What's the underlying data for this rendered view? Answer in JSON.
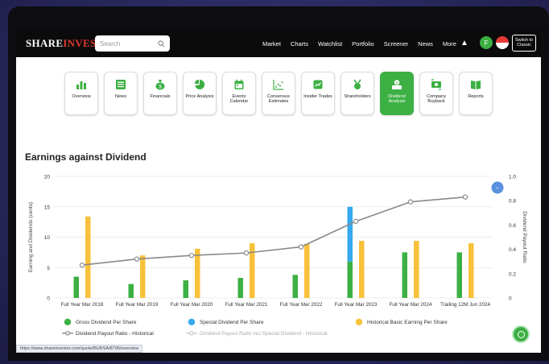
{
  "header": {
    "logo_part1": "SHARE",
    "logo_part2": "INVESTOR",
    "search_placeholder": "Search",
    "nav": [
      "Market",
      "Charts",
      "Watchlist",
      "Portfolio",
      "Screener",
      "News",
      "More"
    ],
    "avatar_letter": "F",
    "switch_label_1": "Switch to",
    "switch_label_2": "Classic"
  },
  "toolbar": [
    {
      "label": "Overview",
      "icon": "bar-chart-icon",
      "active": false
    },
    {
      "label": "News",
      "icon": "newspaper-icon",
      "active": false
    },
    {
      "label": "Financials",
      "icon": "money-bag-icon",
      "active": false
    },
    {
      "label": "Price Analysis",
      "icon": "pie-chart-icon",
      "active": false
    },
    {
      "label": "Events Calendar",
      "icon": "calendar-icon",
      "active": false
    },
    {
      "label": "Consensus Estimates",
      "icon": "scatter-icon",
      "active": false
    },
    {
      "label": "Insider Trades",
      "icon": "insider-trade-icon",
      "active": false
    },
    {
      "label": "Shareholders",
      "icon": "shareholders-icon",
      "active": false
    },
    {
      "label": "Dividend Analysis",
      "icon": "dividend-icon",
      "active": true
    },
    {
      "label": "Company Buyback",
      "icon": "buyback-icon",
      "active": false
    },
    {
      "label": "Reports",
      "icon": "book-icon",
      "active": false
    }
  ],
  "section_title": "Earnings against Dividend",
  "status_url": "https://www.shareinvestor.com/quote/BURSA/8796/overview",
  "colors": {
    "accent_green": "#3cb043",
    "gross_dividend": "#3cb043",
    "special_dividend": "#35aaf0",
    "basic_eps": "#f8c13a",
    "payout_line": "#8a8a8a"
  },
  "chart_data": {
    "type": "bar",
    "categories": [
      "Full Year Mar 2018",
      "Full Year Mar 2019",
      "Full Year Mar 2020",
      "Full Year Mar 2021",
      "Full Year Mar 2022",
      "Full Year Mar 2023",
      "Full Year Mar 2024",
      "Trailing 12M Jun 2024"
    ],
    "ylabel": "Earning and Dividends (cents)",
    "y2label": "Dividend Payout Ratio",
    "ylim": [
      0,
      20
    ],
    "y2lim": [
      0,
      1.0
    ],
    "yticks": [
      "0",
      "5",
      "10",
      "15",
      "20"
    ],
    "y2ticks": [
      "0",
      "0.2",
      "0.4",
      "0.6",
      "0.8",
      "1.0"
    ],
    "grid": "horizontal",
    "legend_position": "bottom",
    "series": [
      {
        "name": "Gross Dividend Per Share",
        "kind": "bar",
        "axis": "left",
        "values": [
          3.5,
          2.3,
          2.9,
          3.3,
          3.8,
          6.0,
          7.5,
          7.5
        ]
      },
      {
        "name": "Special Dividend Per Share",
        "kind": "bar-stacked",
        "axis": "left",
        "values": [
          0,
          0,
          0,
          0,
          0,
          9.0,
          0,
          0
        ]
      },
      {
        "name": "Historical Basic Earning Per Share",
        "kind": "bar",
        "axis": "left",
        "values": [
          13.4,
          7.0,
          8.1,
          9.0,
          8.9,
          9.4,
          9.4,
          9.0
        ]
      },
      {
        "name": "Dividend Payout Ratio - Historical",
        "kind": "line",
        "axis": "right",
        "values": [
          0.27,
          0.32,
          0.35,
          0.37,
          0.42,
          0.63,
          0.79,
          0.83
        ]
      },
      {
        "name": "Dividend Payout Ratio incl Special Dividend - Historical",
        "kind": "line",
        "axis": "right",
        "disabled": true,
        "values": []
      }
    ]
  }
}
